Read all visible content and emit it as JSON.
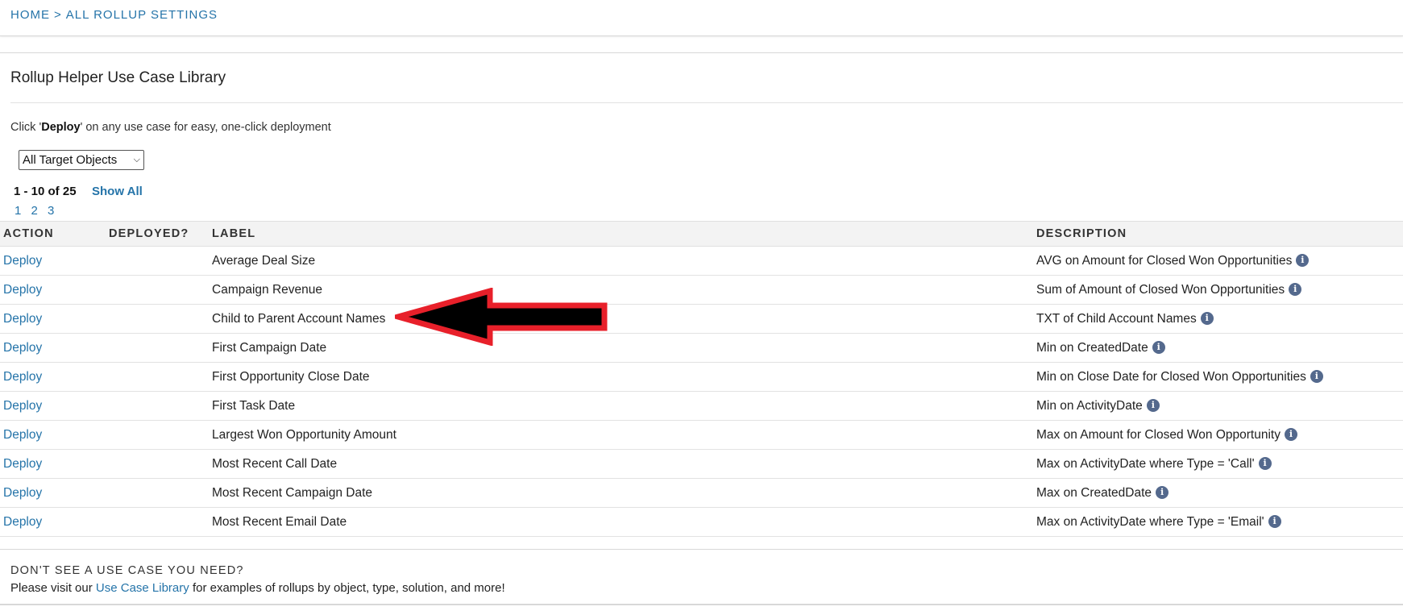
{
  "breadcrumb": {
    "home": "HOME",
    "separator": ">",
    "current": "ALL ROLLUP SETTINGS"
  },
  "page": {
    "title": "Rollup Helper Use Case Library",
    "intro_prefix": "Click '",
    "intro_bold": "Deploy",
    "intro_suffix": "' on any use case for easy, one-click deployment"
  },
  "filter": {
    "selected": "All Target Objects"
  },
  "paging": {
    "info": "1 - 10 of 25",
    "show_all": "Show All",
    "pages": [
      "1",
      "2",
      "3"
    ]
  },
  "table": {
    "headers": {
      "action": "ACTION",
      "deployed": "DEPLOYED?",
      "label": "LABEL",
      "description": "DESCRIPTION"
    },
    "rows": [
      {
        "action": "Deploy",
        "deployed": "",
        "label": "Average Deal Size",
        "description": "AVG on Amount for Closed Won Opportunities"
      },
      {
        "action": "Deploy",
        "deployed": "",
        "label": "Campaign Revenue",
        "description": "Sum of Amount of Closed Won Opportunities"
      },
      {
        "action": "Deploy",
        "deployed": "",
        "label": "Child to Parent Account Names",
        "description": "TXT of Child Account Names"
      },
      {
        "action": "Deploy",
        "deployed": "",
        "label": "First Campaign Date",
        "description": "Min on CreatedDate"
      },
      {
        "action": "Deploy",
        "deployed": "",
        "label": "First Opportunity Close Date",
        "description": "Min on Close Date for Closed Won Opportunities"
      },
      {
        "action": "Deploy",
        "deployed": "",
        "label": "First Task Date",
        "description": "Min on ActivityDate"
      },
      {
        "action": "Deploy",
        "deployed": "",
        "label": "Largest Won Opportunity Amount",
        "description": "Max on Amount for Closed Won Opportunity"
      },
      {
        "action": "Deploy",
        "deployed": "",
        "label": "Most Recent Call Date",
        "description": "Max on ActivityDate where Type = 'Call'"
      },
      {
        "action": "Deploy",
        "deployed": "",
        "label": "Most Recent Campaign Date",
        "description": "Max on CreatedDate"
      },
      {
        "action": "Deploy",
        "deployed": "",
        "label": "Most Recent Email Date",
        "description": "Max on ActivityDate where Type = 'Email'"
      }
    ]
  },
  "footer": {
    "heading": "DON'T SEE A USE CASE YOU NEED?",
    "text_prefix": "Please visit our ",
    "link": "Use Case Library",
    "text_suffix": " for examples of rollups by object, type, solution, and more!"
  },
  "icons": {
    "info": "info-icon",
    "annotation": "left-arrow-annotation",
    "info_glyph": "i"
  },
  "colors": {
    "link": "#2574a9",
    "info_icon": "#54698d",
    "arrow_fill": "#000000",
    "arrow_stroke": "#e8202a"
  }
}
